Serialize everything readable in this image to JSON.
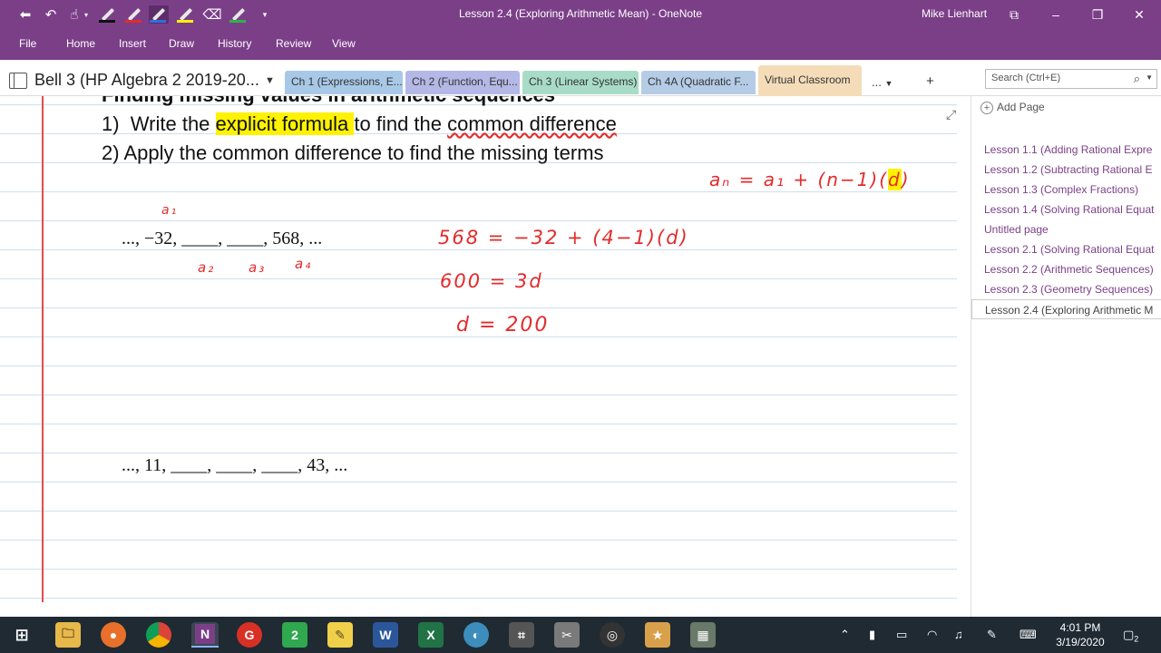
{
  "window": {
    "title": "Lesson 2.4 (Exploring Arithmetic Mean)  -  OneNote",
    "user": "Mike Lienhart"
  },
  "quick_access": {
    "icons": [
      "back-icon",
      "undo-icon",
      "touch-draw-icon",
      "pen-black-icon",
      "pen-red-icon",
      "pen-blue-icon",
      "highlighter-yellow-icon",
      "eraser-icon",
      "pen-green-icon",
      "customize-icon"
    ]
  },
  "ribbon": {
    "tabs": [
      "File",
      "Home",
      "Insert",
      "Draw",
      "History",
      "Review",
      "View"
    ]
  },
  "notebook": {
    "name": "Bell 3 (HP Algebra 2 2019-20...",
    "sections": [
      {
        "label": "Ch 1 (Expressions, E...",
        "color": "#a8c8e8"
      },
      {
        "label": "Ch 2 (Function, Equ...",
        "color": "#b4b8e6"
      },
      {
        "label": "Ch 3 (Linear Systems)",
        "color": "#a8dcc8"
      },
      {
        "label": "Ch 4A (Quadratic F...",
        "color": "#b4cce6"
      },
      {
        "label": "Virtual Classroom",
        "color": "#f4dcb8"
      }
    ],
    "more_label": "...",
    "add_label": "+",
    "search_placeholder": "Search (Ctrl+E)"
  },
  "page": {
    "cut_heading": "Finding missing values in arithmetic sequences",
    "step1_num": "1)",
    "step1_pre": "Write the ",
    "step1_hl": "explicit formula ",
    "step1_post": "to find the ",
    "step1_ul": "common difference",
    "step2": "2)  Apply the common difference to find the missing terms",
    "seq1": "...,  −32,  ____,  ____,  568,  ...",
    "seq2": "...,  11,  ____,  ____,  ____,  43,  ...",
    "ink": {
      "a1": "a₁",
      "a2": "a₂",
      "a3": "a₃",
      "a4": "a₄",
      "formula_pre": "aₙ = a₁ + (n−1)(",
      "formula_d": "d",
      "formula_post": ")",
      "eq1": "568 = −32 + (4−1)(d)",
      "eq2": "600 = 3d",
      "eq3": "d = 200"
    }
  },
  "pages_panel": {
    "add_page_label": "Add Page",
    "items": [
      "Lesson 1.1 (Adding Rational Expre",
      "Lesson 1.2 (Subtracting Rational E",
      "Lesson 1.3 (Complex Fractions)",
      "Lesson 1.4 (Solving Rational Equat",
      "Untitled page",
      "Lesson 2.1 (Solving Rational Equat",
      "Lesson 2.2 (Arithmetic Sequences)",
      "Lesson 2.3 (Geometry Sequences)",
      "Lesson 2.4 (Exploring Arithmetic M"
    ],
    "active_index": 8
  },
  "taskbar": {
    "time": "4:01 PM",
    "date": "3/19/2020",
    "notification_count": "2"
  }
}
